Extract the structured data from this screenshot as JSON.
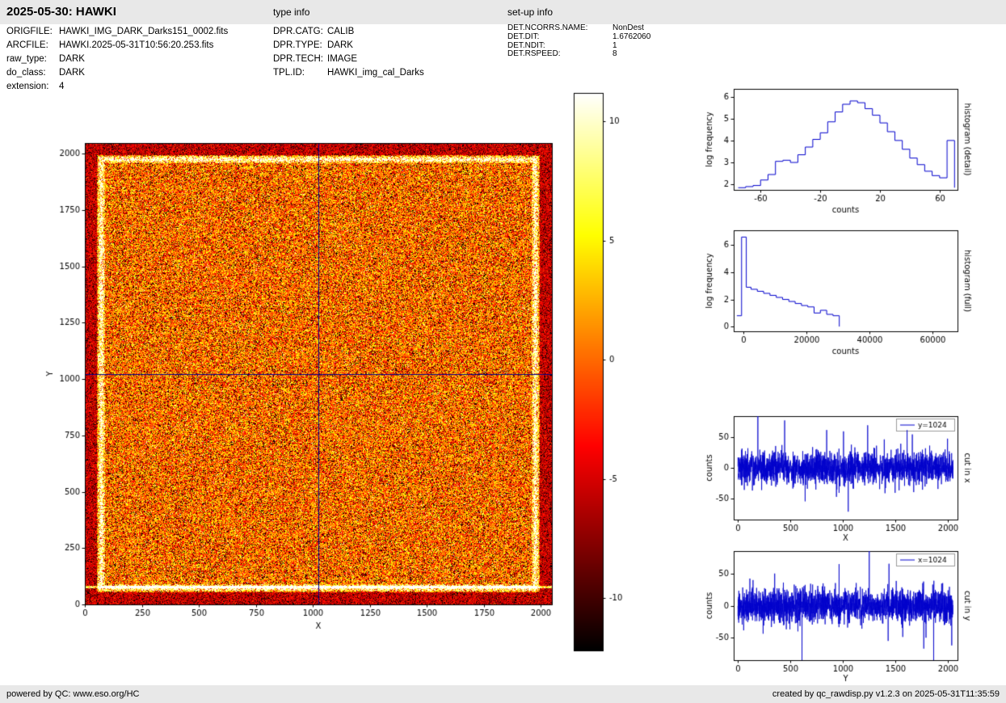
{
  "header": {
    "title": "2025-05-30: HAWKI",
    "type_info_label": "type info",
    "setup_info_label": "set-up info"
  },
  "metadata": {
    "left": [
      {
        "label": "ORIGFILE:",
        "value": "HAWKI_IMG_DARK_Darks151_0002.fits"
      },
      {
        "label": "ARCFILE:",
        "value": "HAWKI.2025-05-31T10:56:20.253.fits"
      },
      {
        "label": "raw_type:",
        "value": "DARK"
      },
      {
        "label": "do_class:",
        "value": "DARK"
      },
      {
        "label": "extension:",
        "value": "4"
      }
    ],
    "type_info": [
      {
        "label": "DPR.CATG:",
        "value": "CALIB"
      },
      {
        "label": "DPR.TYPE:",
        "value": "DARK"
      },
      {
        "label": "DPR.TECH:",
        "value": "IMAGE"
      },
      {
        "label": "TPL.ID:",
        "value": "HAWKI_img_cal_Darks"
      }
    ],
    "setup_info": [
      {
        "label": "DET.NCORRS.NAME:",
        "value": "NonDest"
      },
      {
        "label": "DET.DIT:",
        "value": "1.6762060"
      },
      {
        "label": "DET.NDIT:",
        "value": "1"
      },
      {
        "label": "DET.RSPEED:",
        "value": "8"
      }
    ]
  },
  "footer": {
    "left": "powered by QC: www.eso.org/HC",
    "right": "created by qc_rawdisp.py v1.2.3 on 2025-05-31T11:35:59"
  },
  "colors": {
    "bar_bg": "#e8e8e8",
    "plot_line": "#0000cc",
    "crosshair": "#00008b"
  },
  "chart_data": [
    {
      "id": "raw_image",
      "type": "heatmap",
      "xlabel": "X",
      "ylabel": "Y",
      "xlim": [
        0,
        2048
      ],
      "ylim": [
        0,
        2048
      ],
      "xticks": [
        0,
        250,
        500,
        750,
        1000,
        1250,
        1500,
        1750,
        2000
      ],
      "yticks": [
        0,
        250,
        500,
        750,
        1000,
        1250,
        1500,
        1750,
        2000
      ],
      "colormap": "hot",
      "crosshair": {
        "x": 1024,
        "y": 1024
      },
      "crosshair_color": "#00008b",
      "colorbar": {
        "ticks": [
          10,
          5,
          0,
          -5,
          -10
        ],
        "vmin": -12.2,
        "vmax": 11.2
      },
      "description": "2048x2048 HAWKI raw dark frame shown with hot colormap: orange noise with black/white speckles, bright glow ring near detector edges, bright row near y=80, dark-blue crosshair cuts at x=1024 and y=1024"
    },
    {
      "id": "histogram_detail",
      "type": "line",
      "style": "step",
      "right_label": "histogram (detail)",
      "xlabel": "counts",
      "ylabel": "log frequency",
      "xlim": [
        -78,
        72
      ],
      "ylim": [
        1.75,
        6.35
      ],
      "xticks": [
        -60,
        -20,
        20,
        60
      ],
      "yticks": [
        2,
        3,
        4,
        5,
        6
      ],
      "line_color": "#0000cc",
      "x": [
        -75,
        -70,
        -65,
        -60,
        -55,
        -50,
        -45,
        -40,
        -35,
        -30,
        -25,
        -20,
        -15,
        -10,
        -5,
        0,
        5,
        10,
        15,
        20,
        25,
        30,
        35,
        40,
        45,
        50,
        55,
        60,
        65,
        70
      ],
      "y": [
        1.85,
        1.9,
        1.95,
        2.2,
        2.45,
        3.05,
        3.1,
        3.0,
        3.35,
        3.7,
        4.05,
        4.35,
        4.85,
        5.3,
        5.65,
        5.8,
        5.72,
        5.45,
        5.15,
        4.8,
        4.4,
        4.0,
        3.6,
        3.2,
        2.9,
        2.6,
        2.4,
        2.3,
        4.0
      ],
      "end_drop": 1.85
    },
    {
      "id": "histogram_full",
      "type": "line",
      "style": "step",
      "right_label": "histogram (full)",
      "xlabel": "counts",
      "ylabel": "log frequency",
      "xlim": [
        -3000,
        68000
      ],
      "ylim": [
        -0.35,
        7.1
      ],
      "xticks": [
        0,
        20000,
        40000,
        60000
      ],
      "yticks": [
        0,
        2,
        4,
        6
      ],
      "line_color": "#0000cc",
      "x": [
        -2000,
        -500,
        1000,
        2500,
        4500,
        6500,
        8500,
        10500,
        12500,
        14500,
        16500,
        18500,
        20500,
        22500,
        24500,
        26500,
        28500,
        30500
      ],
      "y": [
        0.8,
        6.6,
        2.9,
        2.75,
        2.6,
        2.45,
        2.3,
        2.15,
        2.0,
        1.85,
        1.7,
        1.55,
        1.45,
        1.0,
        1.2,
        0.9,
        0.8
      ],
      "end_drop": 0
    },
    {
      "id": "cut_x",
      "type": "line",
      "right_label": "cut in x",
      "legend": "y=1024",
      "xlabel": "X",
      "ylabel": "counts",
      "xlim": [
        -40,
        2090
      ],
      "ylim": [
        -85,
        85
      ],
      "xticks": [
        0,
        500,
        1000,
        1500,
        2000
      ],
      "yticks": [
        -50,
        0,
        50
      ],
      "line_color": "#0000cc",
      "noise": {
        "n": 2048,
        "mean": 0,
        "sigma": 13,
        "seed": 20240531,
        "spikes": [
          {
            "x": 190,
            "v": 150
          },
          {
            "x": 445,
            "v": 78
          },
          {
            "x": 640,
            "v": -55
          },
          {
            "x": 1005,
            "v": 60
          },
          {
            "x": 1050,
            "v": -72
          },
          {
            "x": 1235,
            "v": 70
          },
          {
            "x": 1610,
            "v": 62
          },
          {
            "x": 1660,
            "v": 55
          },
          {
            "x": 1995,
            "v": 48
          }
        ]
      }
    },
    {
      "id": "cut_y",
      "type": "line",
      "right_label": "cut in y",
      "legend": "x=1024",
      "xlabel": "Y",
      "ylabel": "counts",
      "xlim": [
        -40,
        2090
      ],
      "ylim": [
        -85,
        85
      ],
      "xticks": [
        0,
        500,
        1000,
        1500,
        2000
      ],
      "yticks": [
        -50,
        0,
        50
      ],
      "line_color": "#0000cc",
      "noise": {
        "n": 2048,
        "mean": 0,
        "sigma": 13,
        "seed": 98765,
        "spikes": [
          {
            "x": 350,
            "v": 50
          },
          {
            "x": 610,
            "v": -92
          },
          {
            "x": 1250,
            "v": 86
          },
          {
            "x": 1430,
            "v": -55
          },
          {
            "x": 1790,
            "v": -50
          },
          {
            "x": 2035,
            "v": -62
          }
        ]
      }
    }
  ]
}
